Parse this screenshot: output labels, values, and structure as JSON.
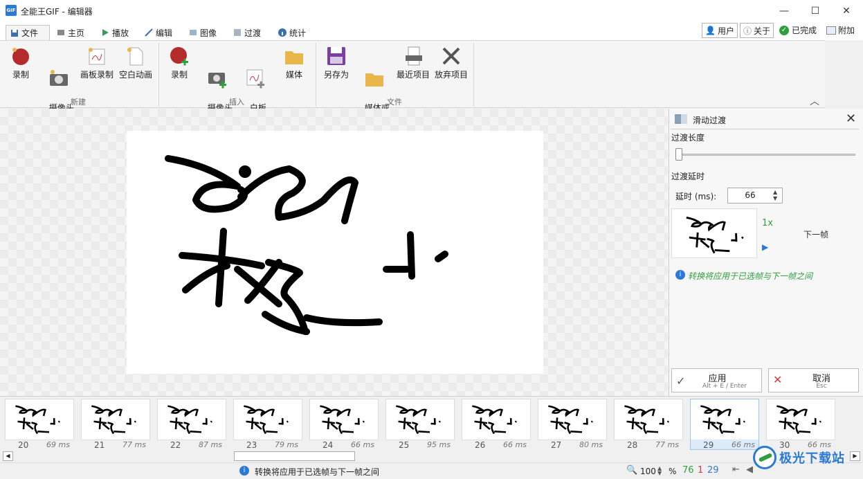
{
  "window": {
    "title": "全能王GIF - 编辑器",
    "app_icon": "GIF",
    "minimize_glyph": "—",
    "maximize_glyph": "☐",
    "close_glyph": "✕"
  },
  "tabs": [
    {
      "label": "文件",
      "icon": "save-icon",
      "active": true
    },
    {
      "label": "主页",
      "icon": "home-icon"
    },
    {
      "label": "播放",
      "icon": "play-icon"
    },
    {
      "label": "编辑",
      "icon": "pencil-icon"
    },
    {
      "label": "图像",
      "icon": "image-icon"
    },
    {
      "label": "过渡",
      "icon": "transition-icon"
    },
    {
      "label": "统计",
      "icon": "info-icon"
    }
  ],
  "top_right": {
    "user": "用户",
    "about": "关于",
    "done": "已完成",
    "addon": "附加"
  },
  "ribbon": {
    "new_group": "新建",
    "insert_group": "插入",
    "file_group": "文件",
    "new_items": [
      "录制",
      "摄像头\n录制",
      "画板录制",
      "空白动画"
    ],
    "insert_items": [
      "录制",
      "摄像头\n录制",
      "白板\n录制",
      "媒体"
    ],
    "file_items": [
      "另存为",
      "媒体或\n项目",
      "最近项目",
      "放弃项目"
    ]
  },
  "panel": {
    "title": "滑动过渡",
    "length_label": "过渡长度",
    "slider_value": 0,
    "delay_section": "过渡延时",
    "delay_label": "延时 (ms):",
    "delay_value": "66",
    "speed": "1x",
    "next_frame": "下一帧",
    "info": "转换将应用于已选帧与下一帧之间",
    "apply": "应用",
    "apply_shortcut": "Alt + E / Enter",
    "cancel": "取消",
    "cancel_shortcut": "Esc"
  },
  "frames": [
    {
      "num": "20",
      "ms": "69 ms"
    },
    {
      "num": "21",
      "ms": "77 ms"
    },
    {
      "num": "22",
      "ms": "87 ms"
    },
    {
      "num": "23",
      "ms": "79 ms"
    },
    {
      "num": "24",
      "ms": "66 ms"
    },
    {
      "num": "25",
      "ms": "95 ms"
    },
    {
      "num": "26",
      "ms": "66 ms"
    },
    {
      "num": "27",
      "ms": "80 ms"
    },
    {
      "num": "28",
      "ms": "77 ms"
    },
    {
      "num": "29",
      "ms": "66 ms",
      "selected": true
    },
    {
      "num": "30",
      "ms": "66 ms"
    }
  ],
  "status": {
    "message": "转换将应用于已选帧与下一帧之间",
    "zoom": "100",
    "zoom_unit": "%",
    "total": "76",
    "selected": "1",
    "current": "29"
  },
  "watermark": "极光下载站",
  "colors": {
    "accent": "#2b79d6",
    "green": "#2e9e3e",
    "red": "#d23c3c",
    "selected_frame": "#dcebf7"
  }
}
